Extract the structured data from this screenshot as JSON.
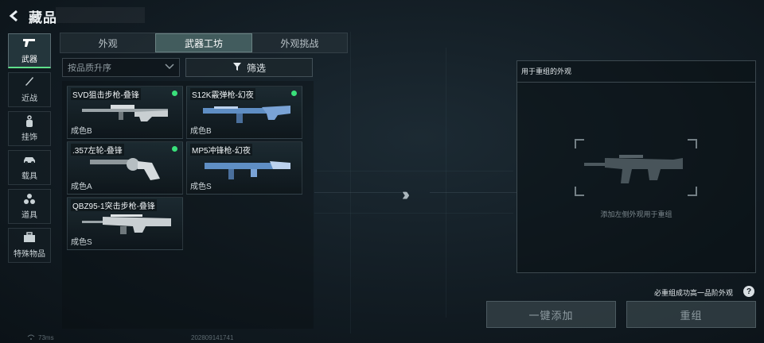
{
  "header": {
    "title": "藏品",
    "back_icon": "back-arrow-icon"
  },
  "nav": {
    "items": [
      {
        "label": "武器",
        "icon": "pistol-icon",
        "active": true
      },
      {
        "label": "近战",
        "icon": "knife-icon",
        "active": false
      },
      {
        "label": "挂饰",
        "icon": "charm-icon",
        "active": false
      },
      {
        "label": "载具",
        "icon": "car-icon",
        "active": false
      },
      {
        "label": "道具",
        "icon": "grenade-icon",
        "active": false
      },
      {
        "label": "特殊物品",
        "icon": "briefcase-icon",
        "active": false
      }
    ]
  },
  "tabs": [
    {
      "label": "外观",
      "active": false
    },
    {
      "label": "武器工坊",
      "active": true
    },
    {
      "label": "外观挑战",
      "active": false
    }
  ],
  "sort": {
    "label": "按品质升序"
  },
  "filter": {
    "label": "筛选"
  },
  "items": [
    {
      "name": "SVD狙击步枪-叠锋",
      "grade": "成色B",
      "new": true
    },
    {
      "name": "S12K霰弹枪-幻夜",
      "grade": "成色B",
      "new": true
    },
    {
      "name": ".357左轮-叠锋",
      "grade": "成色A",
      "new": true
    },
    {
      "name": "MP5冲锋枪-幻夜",
      "grade": "成色S",
      "new": false
    },
    {
      "name": "QBZ95-1突击步枪-叠锋",
      "grade": "成色S",
      "new": false
    }
  ],
  "recombine": {
    "panel_title": "用于重组的外观",
    "hint": "添加左侧外观用于重组",
    "help_text": "必重组成功高一品阶外观",
    "add_button": "一键添加",
    "recombine_button": "重组"
  },
  "footer": {
    "ping": "73ms",
    "build": "202809141741"
  },
  "colors": {
    "accent_green": "#39e07a",
    "panel_border": "#aabec8"
  }
}
